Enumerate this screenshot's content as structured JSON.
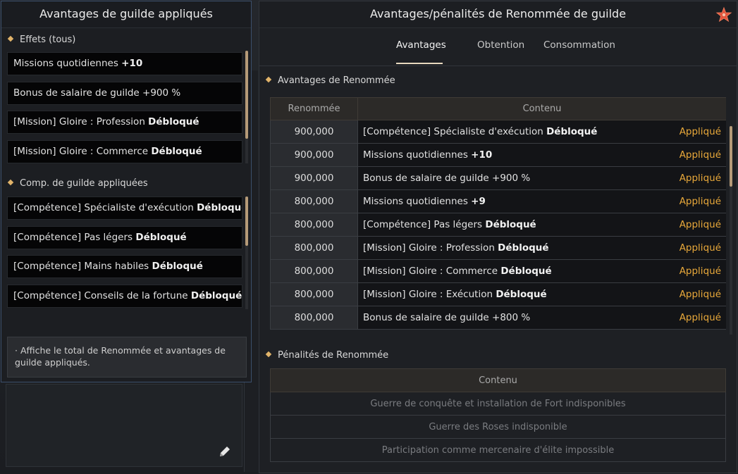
{
  "left_panel": {
    "title": "Avantages de guilde appliqués",
    "effects_section": {
      "heading": "Effets (tous)",
      "items": [
        {
          "text": "Missions quotidiennes ",
          "bold": "+10"
        },
        {
          "text": "Bonus de salaire de guilde +900 %",
          "bold": ""
        },
        {
          "text": "[Mission] Gloire : Profession ",
          "bold": "Débloqué"
        },
        {
          "text": "[Mission] Gloire : Commerce ",
          "bold": "Débloqué"
        }
      ]
    },
    "skills_section": {
      "heading": "Comp. de guilde appliquées",
      "items": [
        {
          "text": "[Compétence] Spécialiste d'exécution ",
          "bold": "Débloqué"
        },
        {
          "text": "[Compétence] Pas légers ",
          "bold": "Débloqué"
        },
        {
          "text": "[Compétence] Mains habiles ",
          "bold": "Débloqué"
        },
        {
          "text": "[Compétence] Conseils de la fortune ",
          "bold": "Débloqué"
        }
      ]
    },
    "description": "· Affiche le total de Renommée et avantages de guilde appliqués."
  },
  "right_panel": {
    "title": "Avantages/pénalités de Renommée de guilde",
    "close_icon": "star-close-icon",
    "tabs": [
      {
        "label": "Avantages",
        "active": true
      },
      {
        "label": "Obtention",
        "active": false
      },
      {
        "label": "Consommation",
        "active": false
      }
    ],
    "advantages": {
      "heading": "Avantages de Renommée",
      "columns": [
        "Renommée",
        "Contenu"
      ],
      "rows": [
        {
          "value": "900,000",
          "text": "[Compétence] Spécialiste d'exécution ",
          "bold": "Débloqué",
          "status": "Appliqué"
        },
        {
          "value": "900,000",
          "text": "Missions quotidiennes ",
          "bold": "+10",
          "status": "Appliqué"
        },
        {
          "value": "900,000",
          "text": "Bonus de salaire de guilde +900 %",
          "bold": "",
          "status": "Appliqué"
        },
        {
          "value": "800,000",
          "text": "Missions quotidiennes ",
          "bold": "+9",
          "status": "Appliqué"
        },
        {
          "value": "800,000",
          "text": "[Compétence] Pas légers ",
          "bold": "Débloqué",
          "status": "Appliqué"
        },
        {
          "value": "800,000",
          "text": "[Mission] Gloire : Profession ",
          "bold": "Débloqué",
          "status": "Appliqué"
        },
        {
          "value": "800,000",
          "text": "[Mission] Gloire : Commerce ",
          "bold": "Débloqué",
          "status": "Appliqué"
        },
        {
          "value": "800,000",
          "text": "[Mission] Gloire : Exécution ",
          "bold": "Débloqué",
          "status": "Appliqué"
        },
        {
          "value": "800,000",
          "text": "Bonus de salaire de guilde +800 %",
          "bold": "",
          "status": "Appliqué"
        }
      ]
    },
    "penalties": {
      "heading": "Pénalités de Renommée",
      "column": "Contenu",
      "rows": [
        "Guerre de conquête et installation de Fort indisponibles",
        "Guerre des Roses indisponible",
        "Participation comme mercenaire d'élite impossible"
      ]
    }
  },
  "background": {
    "edit_icon": "pencil-icon"
  },
  "colors": {
    "accent_gold": "#e8a83a",
    "diamond": "#e2b46a",
    "panel_border": "#3b4f6b",
    "close_star": "#e2523a"
  }
}
